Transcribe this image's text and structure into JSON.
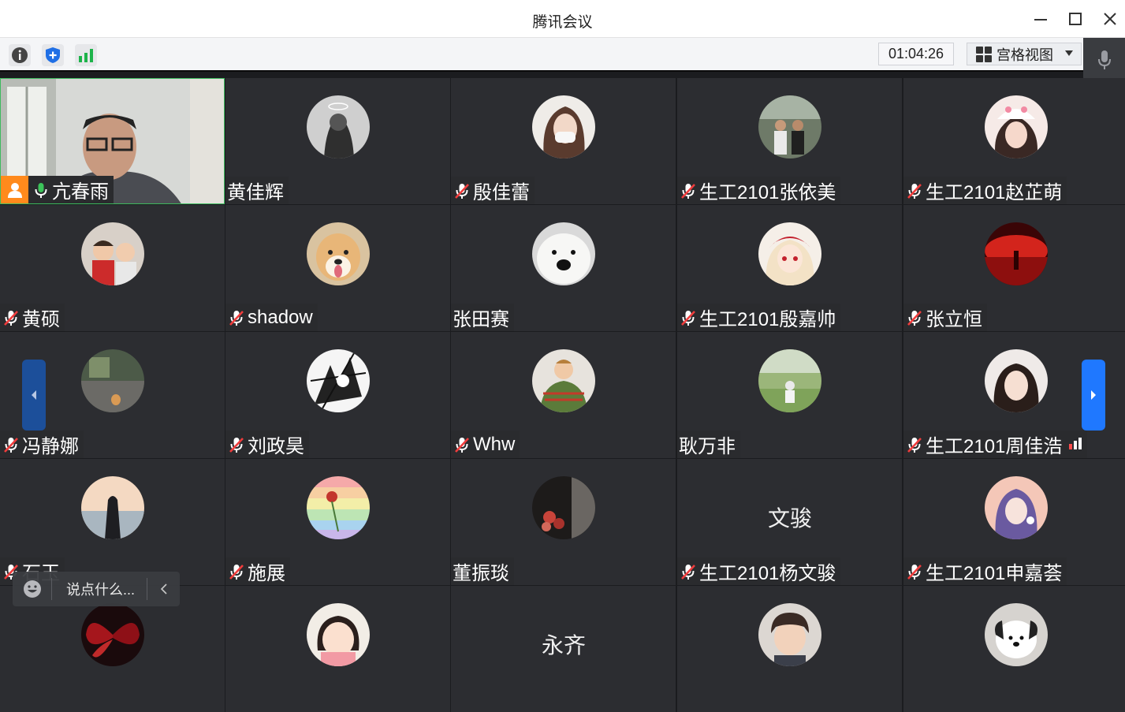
{
  "window": {
    "title": "腾讯会议"
  },
  "toolbar": {
    "timer": "01:04:26",
    "view_mode": "宫格视图"
  },
  "chat": {
    "placeholder": "说点什么..."
  },
  "tiles": [
    {
      "name": "亢春雨",
      "muted": false,
      "self": true,
      "avatar": "camera-video"
    },
    {
      "name": "黄佳辉",
      "muted": false,
      "avatar": "sketch-bw"
    },
    {
      "name": "殷佳蕾",
      "muted": true,
      "avatar": "girl-mask"
    },
    {
      "name": "生工2101张依美",
      "muted": true,
      "avatar": "group-photo"
    },
    {
      "name": "生工2101赵芷萌",
      "muted": true,
      "avatar": "girl-hat"
    },
    {
      "name": "黄硕",
      "muted": true,
      "avatar": "kids-photo"
    },
    {
      "name": "shadow",
      "muted": true,
      "avatar": "shiba-dog"
    },
    {
      "name": "张田赛",
      "muted": false,
      "avatar": "polar-bear"
    },
    {
      "name": "生工2101殷嘉帅",
      "muted": true,
      "avatar": "anime-girl"
    },
    {
      "name": "张立恒",
      "muted": true,
      "avatar": "red-tree"
    },
    {
      "name": "冯静娜",
      "muted": true,
      "avatar": "cat-stairs"
    },
    {
      "name": "刘政昊",
      "muted": true,
      "avatar": "manga-art"
    },
    {
      "name": "Whw",
      "muted": true,
      "avatar": "child-sweater"
    },
    {
      "name": "耿万非",
      "muted": false,
      "avatar": "grass-field"
    },
    {
      "name": "生工2101周佳浩",
      "muted": true,
      "avatar": "girl-portrait",
      "signal": true
    },
    {
      "name": "石玉",
      "muted": true,
      "avatar": "sunset-girl"
    },
    {
      "name": "施展",
      "muted": true,
      "avatar": "rainbow-rose"
    },
    {
      "name": "董振琰",
      "muted": false,
      "avatar": "roses-dark"
    },
    {
      "name": "生工2101杨文骏",
      "muted": true,
      "avatar_text": "文骏"
    },
    {
      "name": "生工2101申嘉荟",
      "muted": true,
      "avatar": "anime-purple"
    },
    {
      "name": "",
      "muted": false,
      "avatar": "red-butterfly"
    },
    {
      "name": "",
      "muted": false,
      "avatar": "baby-girl"
    },
    {
      "name": "",
      "muted": false,
      "avatar_text": "永齐"
    },
    {
      "name": "",
      "muted": false,
      "avatar": "cartoon-boy"
    },
    {
      "name": "",
      "muted": false,
      "avatar": "pochacco"
    }
  ]
}
